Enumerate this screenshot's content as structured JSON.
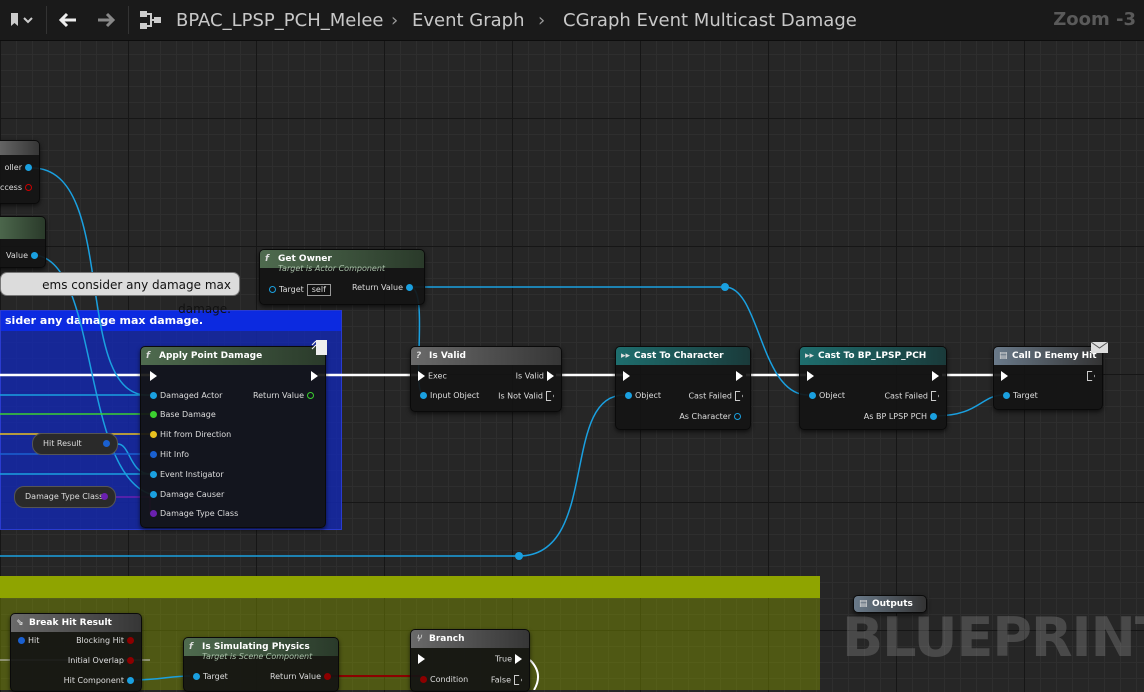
{
  "breadcrumb": {
    "blueprint": "BPAC_LPSP_PCH_Melee",
    "graph": "Event Graph",
    "function": "CGraph Event Multicast Damage",
    "zoom": "Zoom -3"
  },
  "watermark": "BLUEPRINT",
  "comment_blue": {
    "title": "sider any damage max damage."
  },
  "bubble_text": "ems consider any damage max damage.",
  "left_fragments": {
    "roller": "oller",
    "success": "ccess",
    "value": "Value"
  },
  "pills": {
    "hit_result": "Hit Result",
    "damage_type_class": "Damage Type Class"
  },
  "nodes": {
    "get_owner": {
      "title": "Get Owner",
      "subtitle": "Target is Actor Component",
      "target": "Target",
      "self": "self",
      "return": "Return Value"
    },
    "apply_point_damage": {
      "title": "Apply Point Damage",
      "pins": [
        "Damaged Actor",
        "Base Damage",
        "Hit from Direction",
        "Hit Info",
        "Event Instigator",
        "Damage Causer",
        "Damage Type Class"
      ],
      "return": "Return Value"
    },
    "is_valid": {
      "title": "Is Valid",
      "exec": "Exec",
      "input": "Input Object",
      "is_valid": "Is Valid",
      "is_not_valid": "Is Not Valid"
    },
    "cast_character": {
      "title": "Cast To Character",
      "object": "Object",
      "cast_failed": "Cast Failed",
      "as": "As Character"
    },
    "cast_bp": {
      "title": "Cast To BP_LPSP_PCH",
      "object": "Object",
      "cast_failed": "Cast Failed",
      "as": "As BP LPSP PCH"
    },
    "call_enemy_hit": {
      "title": "Call D Enemy Hit",
      "target": "Target"
    },
    "outputs": {
      "title": "Outputs"
    },
    "break_hit": {
      "title": "Break Hit Result",
      "hit": "Hit",
      "blocking": "Blocking Hit",
      "initial_overlap": "Initial Overlap",
      "hit_component": "Hit Component"
    },
    "is_simulating": {
      "title": "Is Simulating Physics",
      "subtitle": "Target is Scene Component",
      "target": "Target",
      "return": "Return Value"
    },
    "branch": {
      "title": "Branch",
      "condition": "Condition",
      "true": "True",
      "false": "False"
    }
  },
  "colors": {
    "wire_object": "#1aa0e0",
    "exec": "#ffffff",
    "bool": "#8c0000",
    "struct": "#0050a0",
    "float": "#3cd030"
  }
}
